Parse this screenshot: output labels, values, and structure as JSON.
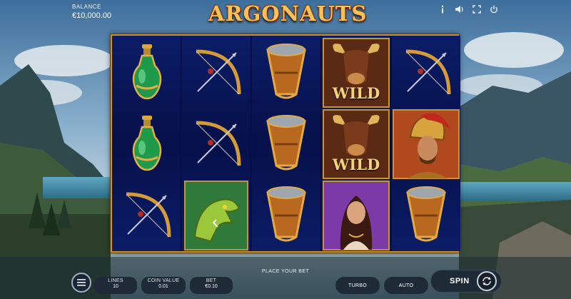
{
  "header": {
    "balance_label": "BALANCE",
    "balance_value": "€10,000.00",
    "logo_text": "ARGONAUTS",
    "icons": [
      "info-icon",
      "sound-icon",
      "fullscreen-icon",
      "power-icon"
    ]
  },
  "reels": [
    [
      "potion",
      "potion",
      "bow"
    ],
    [
      "bow",
      "bow",
      "dragon"
    ],
    [
      "bell",
      "bell",
      "bell"
    ],
    [
      "wild",
      "wild",
      "woman"
    ],
    [
      "bow",
      "warrior",
      "bell"
    ]
  ],
  "wild_label": "WILD",
  "controls": {
    "lines_label": "LINES",
    "lines_value": "10",
    "coin_value_label": "COIN VALUE",
    "coin_value": "0.01",
    "bet_label": "BET",
    "bet_value": "€0.10",
    "status_text": "PLACE YOUR BET",
    "turbo_label": "TURBO",
    "auto_label": "AUTO",
    "spin_label": "SPIN"
  },
  "colors": {
    "frame_gold": "#c9932f",
    "reel_blue": "#0b1d66",
    "ui_dark": "#1e2a36"
  }
}
